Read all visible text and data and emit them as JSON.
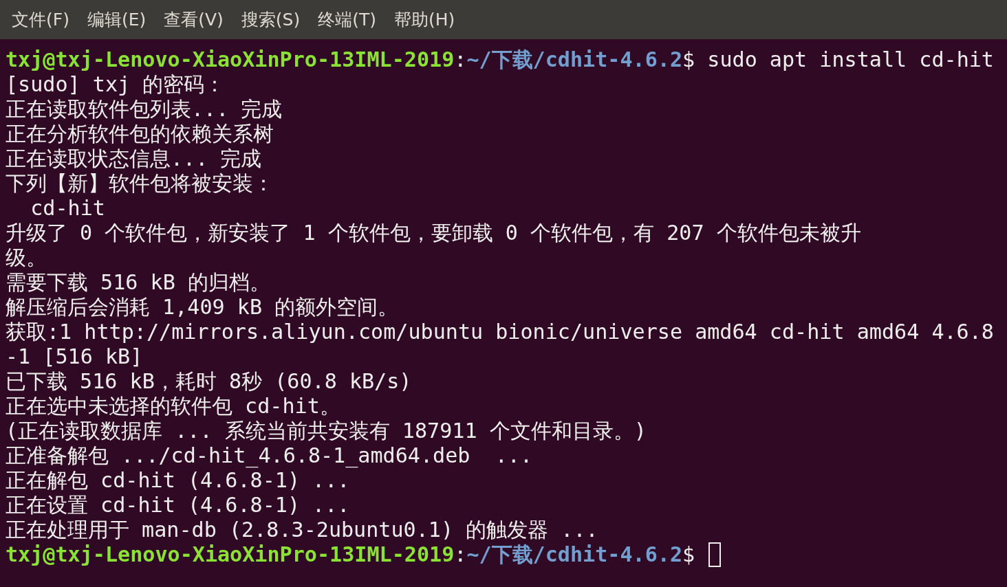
{
  "menu": [
    {
      "label": "文件(F)"
    },
    {
      "label": "编辑(E)"
    },
    {
      "label": "查看(V)"
    },
    {
      "label": "搜索(S)"
    },
    {
      "label": "终端(T)"
    },
    {
      "label": "帮助(H)"
    }
  ],
  "lines": [
    {
      "kind": "prompt",
      "user": "txj@txj-Lenovo-XiaoXinPro-13IML-2019",
      "sep": ":",
      "path": "~/下载/cdhit-4.6.2",
      "symbol": "$",
      "command": " sudo apt install cd-hit"
    },
    {
      "kind": "output",
      "text": "[sudo] txj 的密码："
    },
    {
      "kind": "output",
      "text": "正在读取软件包列表... 完成"
    },
    {
      "kind": "output",
      "text": "正在分析软件包的依赖关系树"
    },
    {
      "kind": "output",
      "text": "正在读取状态信息... 完成"
    },
    {
      "kind": "output",
      "text": "下列【新】软件包将被安装："
    },
    {
      "kind": "output",
      "text": "  cd-hit"
    },
    {
      "kind": "output",
      "text": "升级了 0 个软件包，新安装了 1 个软件包，要卸载 0 个软件包，有 207 个软件包未被升"
    },
    {
      "kind": "output",
      "text": "级。"
    },
    {
      "kind": "output",
      "text": "需要下载 516 kB 的归档。"
    },
    {
      "kind": "output",
      "text": "解压缩后会消耗 1,409 kB 的额外空间。"
    },
    {
      "kind": "output",
      "text": "获取:1 http://mirrors.aliyun.com/ubuntu bionic/universe amd64 cd-hit amd64 4.6.8"
    },
    {
      "kind": "output",
      "text": "-1 [516 kB]"
    },
    {
      "kind": "output",
      "text": "已下载 516 kB，耗时 8秒 (60.8 kB/s)"
    },
    {
      "kind": "output",
      "text": "正在选中未选择的软件包 cd-hit。"
    },
    {
      "kind": "output",
      "text": "(正在读取数据库 ... 系统当前共安装有 187911 个文件和目录。)"
    },
    {
      "kind": "output",
      "text": "正准备解包 .../cd-hit_4.6.8-1_amd64.deb  ..."
    },
    {
      "kind": "output",
      "text": "正在解包 cd-hit (4.6.8-1) ..."
    },
    {
      "kind": "output",
      "text": "正在设置 cd-hit (4.6.8-1) ..."
    },
    {
      "kind": "output",
      "text": "正在处理用于 man-db (2.8.3-2ubuntu0.1) 的触发器 ..."
    },
    {
      "kind": "prompt",
      "user": "txj@txj-Lenovo-XiaoXinPro-13IML-2019",
      "sep": ":",
      "path": "~/下载/cdhit-4.6.2",
      "symbol": "$",
      "cursor": true
    }
  ]
}
